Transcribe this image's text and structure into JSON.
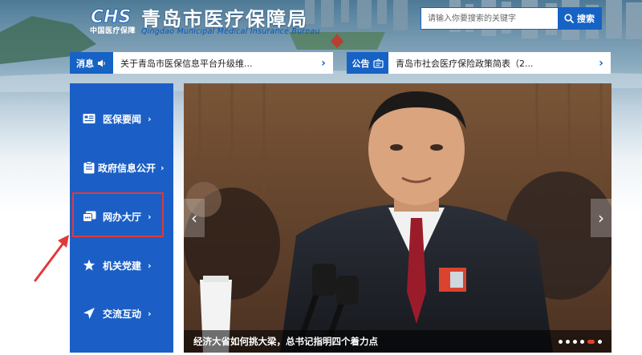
{
  "header": {
    "logo_text": "CHS",
    "logo_subtext": "中国医疗保障",
    "title": "青岛市医疗保障局",
    "subtitle": "Qingdao Municipal Medical Insurance Bureau"
  },
  "search": {
    "placeholder": "请输入你要搜索的关键字",
    "button_label": "搜索"
  },
  "news_bar": {
    "tag": "消息",
    "text": "关于青岛市医保信息平台升级维...",
    "arrow": "›"
  },
  "notice_bar": {
    "tag": "公告",
    "text": "青岛市社会医疗保险政策简表（2...",
    "arrow": "›"
  },
  "sidebar": {
    "items": [
      {
        "label": "医保要闻",
        "icon": "news-icon",
        "chevron": "›"
      },
      {
        "label": "政府信息公开",
        "icon": "clipboard-icon",
        "chevron": "›"
      },
      {
        "label": "网办大厅",
        "icon": "service-hall-icon",
        "chevron": "›"
      },
      {
        "label": "机关党建",
        "icon": "party-star-icon",
        "chevron": "›"
      },
      {
        "label": "交流互动",
        "icon": "send-icon",
        "chevron": "›"
      }
    ]
  },
  "carousel": {
    "caption": "经济大省如何挑大梁，总书记指明四个着力点",
    "dots_total": 6,
    "active_dot": 5,
    "left_arrow": "‹",
    "right_arrow": "›"
  },
  "colors": {
    "brand_blue": "#1663c5",
    "sidebar_blue": "#1b5fc6",
    "highlight_red": "#e03a3a"
  }
}
